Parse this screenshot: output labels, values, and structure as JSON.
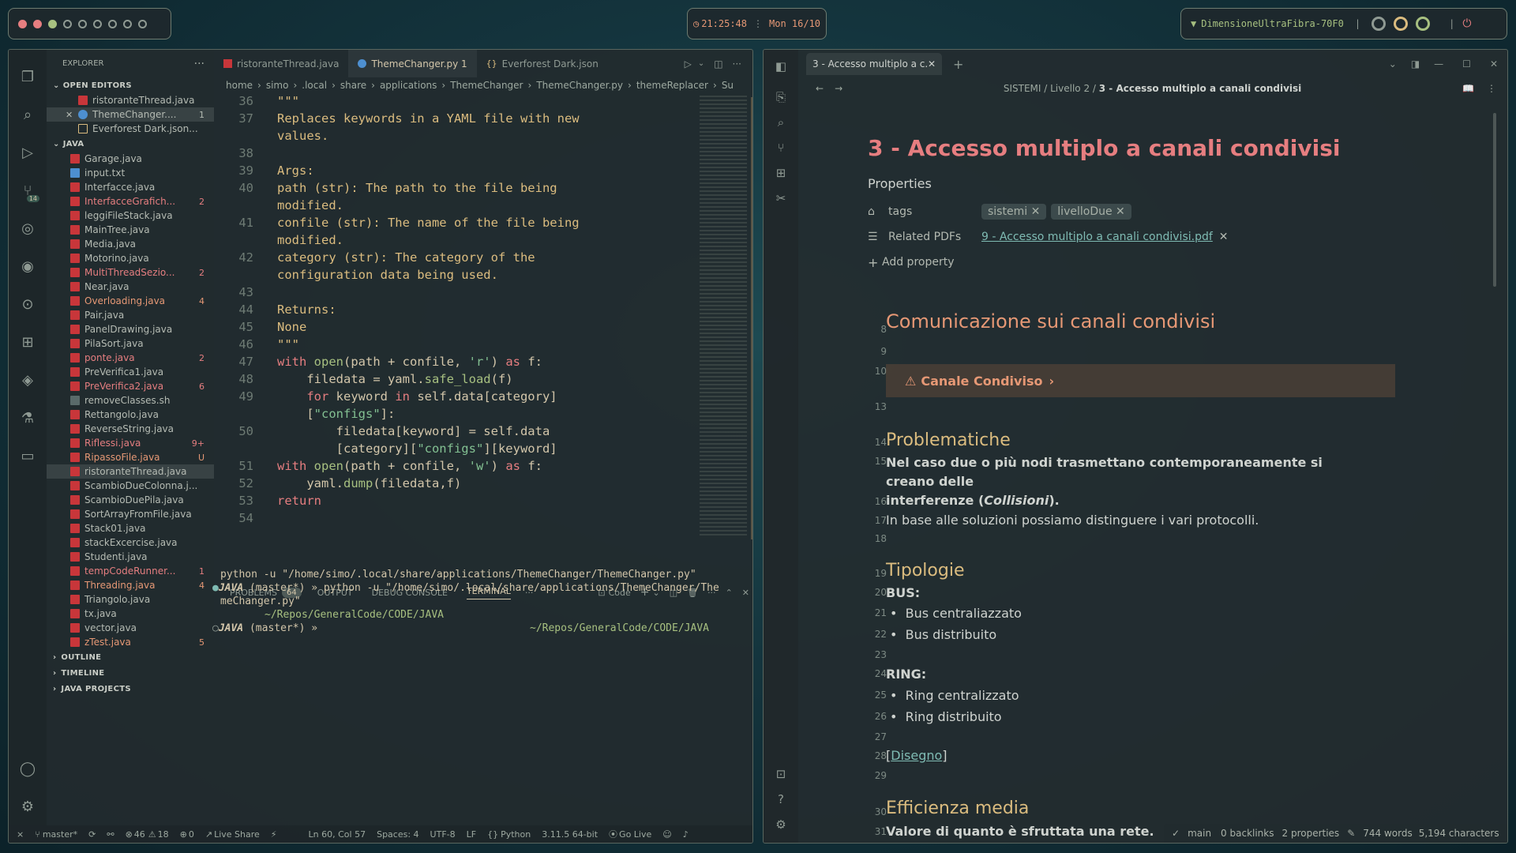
{
  "topbar": {
    "time": "21:25:48",
    "date": "Mon 16/10",
    "wifi": "DimensioneUltraFibra-70F0"
  },
  "vscode": {
    "explorer_title": "EXPLORER",
    "open_editors_label": "OPEN EDITORS",
    "open_editors": [
      {
        "name": "ristoranteThread.java",
        "icon": "java-icon"
      },
      {
        "name": "ThemeChanger....",
        "badge": "1",
        "icon": "python-icon"
      },
      {
        "name": "Everforest Dark.json...",
        "icon": "json-icon"
      }
    ],
    "java_label": "JAVA",
    "files": [
      {
        "name": "Garage.java",
        "badge": "",
        "state": "normal",
        "icon": "java-icon"
      },
      {
        "name": "input.txt",
        "badge": "",
        "state": "normal",
        "icon": "txt-icon"
      },
      {
        "name": "Interfacce.java",
        "badge": "",
        "state": "normal",
        "icon": "java-icon"
      },
      {
        "name": "InterfacceGrafich...",
        "badge": "2",
        "state": "err",
        "icon": "java-icon"
      },
      {
        "name": "leggiFileStack.java",
        "badge": "",
        "state": "normal",
        "icon": "java-icon"
      },
      {
        "name": "MainTree.java",
        "badge": "",
        "state": "normal",
        "icon": "java-icon"
      },
      {
        "name": "Media.java",
        "badge": "",
        "state": "normal",
        "icon": "java-icon"
      },
      {
        "name": "Motorino.java",
        "badge": "",
        "state": "normal",
        "icon": "java-icon"
      },
      {
        "name": "MultiThreadSezio...",
        "badge": "2",
        "state": "err",
        "icon": "java-icon"
      },
      {
        "name": "Near.java",
        "badge": "",
        "state": "normal",
        "icon": "java-icon"
      },
      {
        "name": "Overloading.java",
        "badge": "4",
        "state": "warn",
        "icon": "java-icon"
      },
      {
        "name": "Pair.java",
        "badge": "",
        "state": "normal",
        "icon": "java-icon"
      },
      {
        "name": "PanelDrawing.java",
        "badge": "",
        "state": "normal",
        "icon": "java-icon"
      },
      {
        "name": "PilaSort.java",
        "badge": "",
        "state": "normal",
        "icon": "java-icon"
      },
      {
        "name": "ponte.java",
        "badge": "2",
        "state": "err",
        "icon": "java-icon"
      },
      {
        "name": "PreVerifica1.java",
        "badge": "",
        "state": "normal",
        "icon": "java-icon"
      },
      {
        "name": "PreVerifica2.java",
        "badge": "6",
        "state": "err",
        "icon": "java-icon"
      },
      {
        "name": "removeClasses.sh",
        "badge": "",
        "state": "normal",
        "icon": "shell-icon"
      },
      {
        "name": "Rettangolo.java",
        "badge": "",
        "state": "normal",
        "icon": "java-icon"
      },
      {
        "name": "ReverseString.java",
        "badge": "",
        "state": "normal",
        "icon": "java-icon"
      },
      {
        "name": "Riflessi.java",
        "badge": "9+",
        "state": "err",
        "icon": "java-icon"
      },
      {
        "name": "RipassoFile.java",
        "badge": "U",
        "state": "warn",
        "icon": "java-icon"
      },
      {
        "name": "ristoranteThread.java",
        "badge": "",
        "state": "sel",
        "icon": "java-icon"
      },
      {
        "name": "ScambioDueColonna.j...",
        "badge": "",
        "state": "normal",
        "icon": "java-icon"
      },
      {
        "name": "ScambioDuePila.java",
        "badge": "",
        "state": "normal",
        "icon": "java-icon"
      },
      {
        "name": "SortArrayFromFile.java",
        "badge": "",
        "state": "normal",
        "icon": "java-icon"
      },
      {
        "name": "Stack01.java",
        "badge": "",
        "state": "normal",
        "icon": "java-icon"
      },
      {
        "name": "stackExcercise.java",
        "badge": "",
        "state": "normal",
        "icon": "java-icon"
      },
      {
        "name": "Studenti.java",
        "badge": "",
        "state": "normal",
        "icon": "java-icon"
      },
      {
        "name": "tempCodeRunner...",
        "badge": "1",
        "state": "err",
        "icon": "java-icon"
      },
      {
        "name": "Threading.java",
        "badge": "4",
        "state": "warn",
        "icon": "java-icon"
      },
      {
        "name": "Triangolo.java",
        "badge": "",
        "state": "normal",
        "icon": "java-icon"
      },
      {
        "name": "tx.java",
        "badge": "",
        "state": "normal",
        "icon": "java-icon"
      },
      {
        "name": "vector.java",
        "badge": "",
        "state": "normal",
        "icon": "java-icon"
      },
      {
        "name": "zTest.java",
        "badge": "5",
        "state": "warn",
        "icon": "java-icon"
      }
    ],
    "outline_label": "OUTLINE",
    "timeline_label": "TIMELINE",
    "java_projects_label": "JAVA PROJECTS",
    "tabs": [
      {
        "label": "ristoranteThread.java",
        "active": false
      },
      {
        "label": "ThemeChanger.py 1",
        "active": true
      },
      {
        "label": "Everforest Dark.json",
        "active": false
      }
    ],
    "breadcrumb": [
      "home",
      "simo",
      ".local",
      "share",
      "applications",
      "ThemeChanger",
      "ThemeChanger.py",
      "themeReplacer",
      "Su"
    ],
    "code_lines": [
      {
        "n": "36",
        "html": "<span class='ds'>\"\"\"</span>"
      },
      {
        "n": "37",
        "html": "<span class='ds'>Replaces keywords in a YAML file with new</span>"
      },
      {
        "n": "",
        "html": "<span class='ds'>values.</span>"
      },
      {
        "n": "38",
        "html": ""
      },
      {
        "n": "39",
        "html": "<span class='ds'>Args:</span>"
      },
      {
        "n": "40",
        "html": "<span class='ds'>path (str): The path to the file being</span>"
      },
      {
        "n": "",
        "html": "<span class='ds'>modified.</span>"
      },
      {
        "n": "41",
        "html": "<span class='ds'>confile (str): The name of the file being</span>"
      },
      {
        "n": "",
        "html": "<span class='ds'>modified.</span>"
      },
      {
        "n": "42",
        "html": "<span class='ds'>category (str): The category of the</span>"
      },
      {
        "n": "",
        "html": "<span class='ds'>configuration data being used.</span>"
      },
      {
        "n": "43",
        "html": ""
      },
      {
        "n": "44",
        "html": "<span class='ds'>Returns:</span>"
      },
      {
        "n": "45",
        "html": "<span class='ds'>None</span>"
      },
      {
        "n": "46",
        "html": "<span class='ds'>\"\"\"</span>"
      },
      {
        "n": "47",
        "html": "<span class='kw'>with</span> <span class='fn'>open</span>(path + confile, <span class='str'>'r'</span>) <span class='kw'>as</span> f:"
      },
      {
        "n": "48",
        "html": "    filedata = yaml.<span class='fn'>safe_load</span>(f)"
      },
      {
        "n": "49",
        "html": "    <span class='kw'>for</span> keyword <span class='kw'>in</span> self.data[category]"
      },
      {
        "n": "",
        "html": "    [<span class='str'>\"configs\"</span>]:"
      },
      {
        "n": "50",
        "html": "        filedata[keyword] = self.data"
      },
      {
        "n": "",
        "html": "        [category][<span class='str'>\"configs\"</span>][keyword]"
      },
      {
        "n": "51",
        "html": "<span class='kw'>with</span> <span class='fn'>open</span>(path + confile, <span class='str'>'w'</span>) <span class='kw'>as</span> f:"
      },
      {
        "n": "52",
        "html": "    yaml.<span class='fn'>dump</span>(filedata,f)"
      },
      {
        "n": "53",
        "html": "<span class='kw'>return</span>"
      },
      {
        "n": "54",
        "html": ""
      }
    ],
    "panel_tabs": {
      "problems": "PROBLEMS",
      "problems_count": "64",
      "output": "OUTPUT",
      "debug": "DEBUG CONSOLE",
      "terminal": "TERMINAL",
      "code_label": "Code"
    },
    "terminal": {
      "line1": "python -u \"/home/simo/.local/share/applications/ThemeChanger/ThemeChanger.py\"",
      "line2_prefix": "JAVA",
      "line2_branch": " (master*) » ",
      "line2_cmd": "python -u \"/home/simo/.local/share/applications/ThemeChanger/The",
      "line3": "meChanger.py\"",
      "line4": "~/Repos/GeneralCode/CODE/JAVA",
      "line5_prefix": "JAVA",
      "line5_branch": " (master*) »",
      "line5_right": "~/Repos/GeneralCode/CODE/JAVA"
    },
    "status": {
      "branch": "master*",
      "errors": "46",
      "warnings": "18",
      "ports": "0",
      "live_share": "Live Share",
      "position": "Ln 60, Col 57",
      "spaces": "Spaces: 4",
      "encoding": "UTF-8",
      "eol": "LF",
      "language": "Python",
      "interpreter": "3.11.5 64-bit",
      "golive": "Go Live"
    }
  },
  "obsidian": {
    "tab_label": "3 - Accesso multiplo a c...",
    "breadcrumb": [
      "SISTEMI",
      "Livello 2",
      "3 - Accesso multiplo a canali condivisi"
    ],
    "title": "3 - Accesso multiplo a canali condivisi",
    "properties_label": "Properties",
    "tags_label": "tags",
    "tags": [
      "sistemi",
      "livelloDue"
    ],
    "related_label": "Related PDFs",
    "related_link": "9 - Accesso multiplo a canali condivisi.pdf",
    "add_property": "Add property",
    "lines": {
      "h1": "Comunicazione sui canali condivisi",
      "callout": "Canale Condiviso",
      "h2": "Problematiche",
      "p1a": "Nel caso due o più nodi trasmettano contemporaneamente si creano delle",
      "p1b": "interferenze (",
      "p1c": "Collisioni",
      "p1d": ").",
      "p2": "In base alle soluzioni possiamo distinguere i vari protocolli.",
      "h3": "Tipologie",
      "bus": "BUS:",
      "bus1": "Bus centraliazzato",
      "bus2": "Bus distribuito",
      "ring": "RING:",
      "ring1": "Ring centralizzato",
      "ring2": "Ring distribuito",
      "disegno": "Disegno",
      "h4": "Efficienza media",
      "p3": "Valore di quanto è sfruttata una rete."
    },
    "line_numbers": [
      "8",
      "9",
      "10",
      "13",
      "14",
      "15",
      "16",
      "17",
      "18",
      "19",
      "20",
      "21",
      "22",
      "23",
      "24",
      "25",
      "26",
      "27",
      "28",
      "29",
      "30",
      "31"
    ],
    "status": {
      "branch": "main",
      "backlinks": "0 backlinks",
      "properties": "2 properties",
      "words": "744 words",
      "chars": "5,194 characters"
    }
  }
}
